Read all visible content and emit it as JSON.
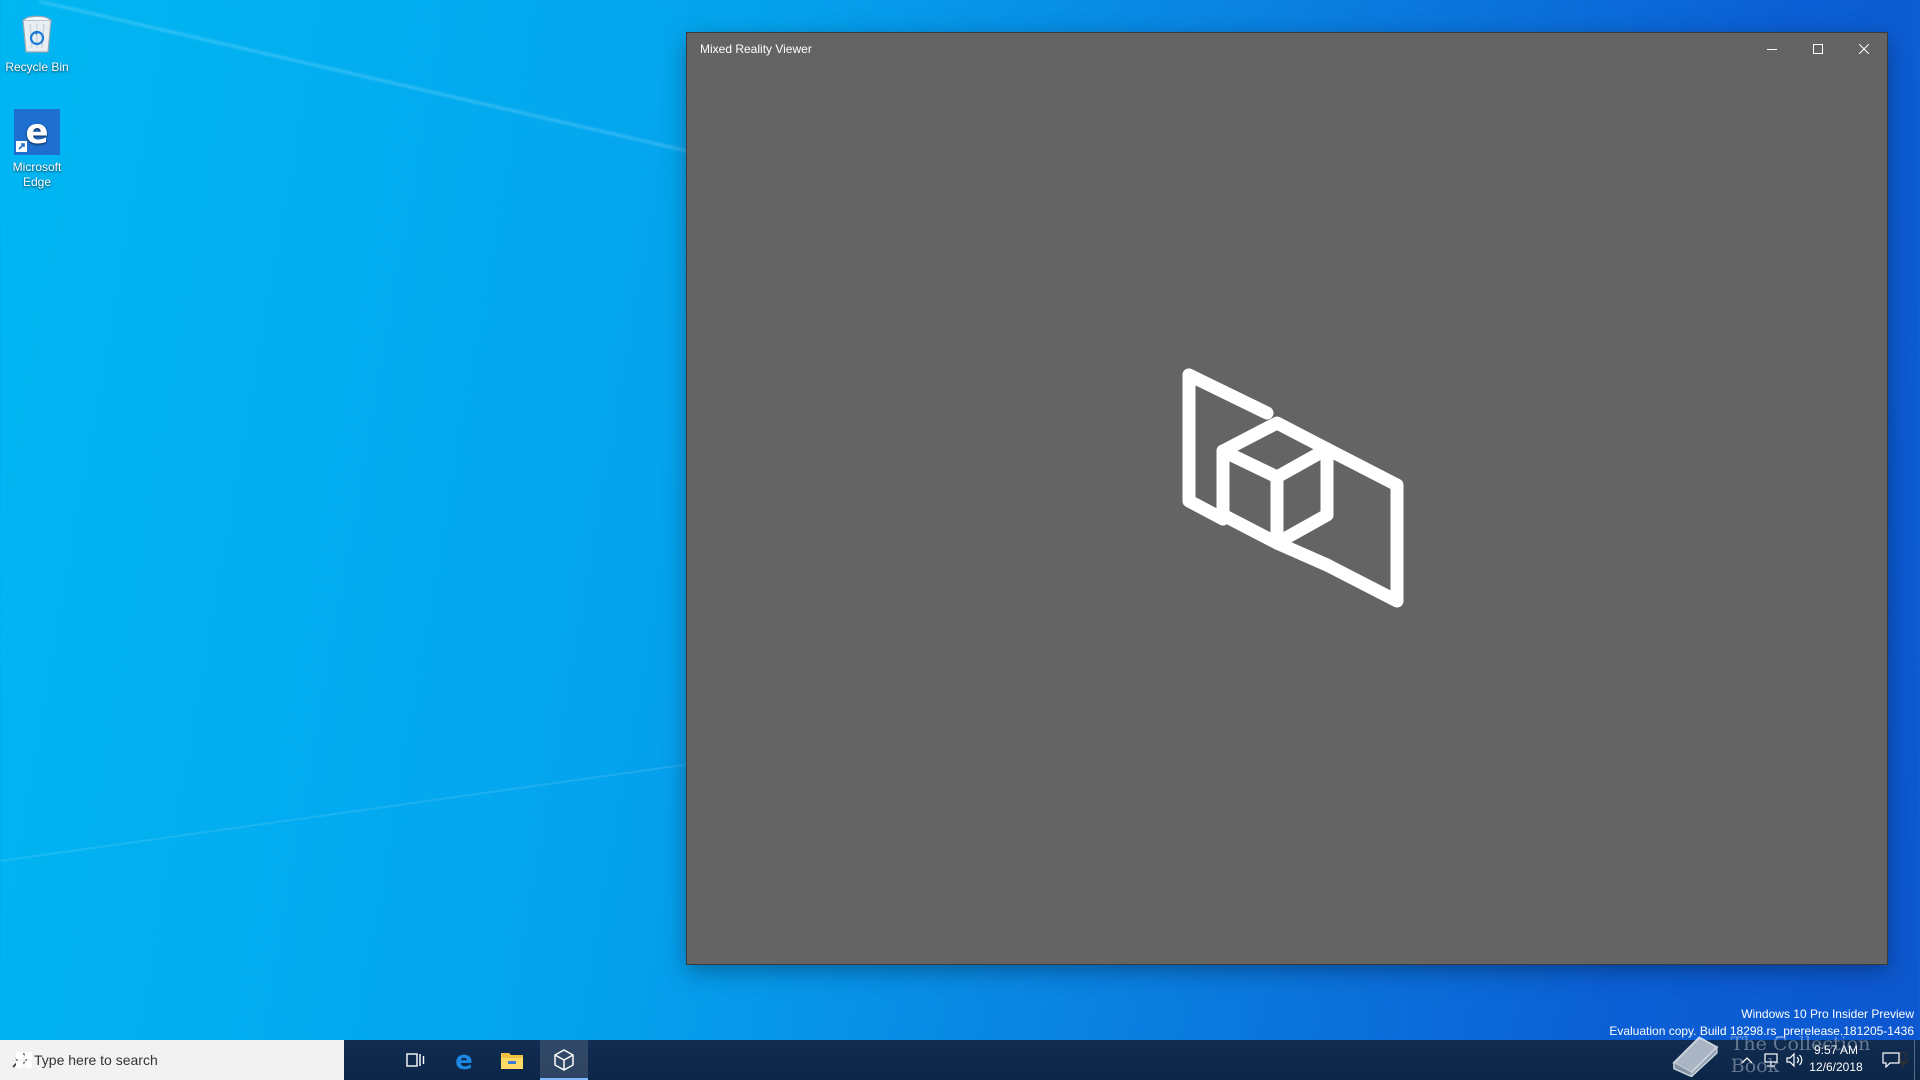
{
  "desktop": {
    "icons": [
      {
        "label": "Recycle Bin",
        "icon": "recycle-bin-icon"
      },
      {
        "label": "Microsoft Edge",
        "icon": "edge-icon"
      }
    ],
    "watermark": {
      "line1": "Windows 10 Pro Insider Preview",
      "line2": "Evaluation copy. Build 18298.rs_prerelease.181205-1436"
    },
    "overlay_logo_text": "The Collection Book"
  },
  "window": {
    "title": "Mixed Reality Viewer",
    "background": "#646464",
    "controls": [
      "minimize",
      "maximize",
      "close"
    ]
  },
  "taskbar": {
    "search_placeholder": "Type here to search",
    "apps": [
      "task-view",
      "microsoft-edge",
      "file-explorer",
      "mixed-reality-viewer"
    ],
    "active_app": "mixed-reality-viewer",
    "clock": {
      "time": "9:57 AM",
      "date": "12/6/2018"
    }
  },
  "colors": {
    "accent": "#0078d7",
    "taskbar": "#0c2648",
    "desktop_top": "#00b7f2",
    "desktop_right": "#0d57cf"
  }
}
